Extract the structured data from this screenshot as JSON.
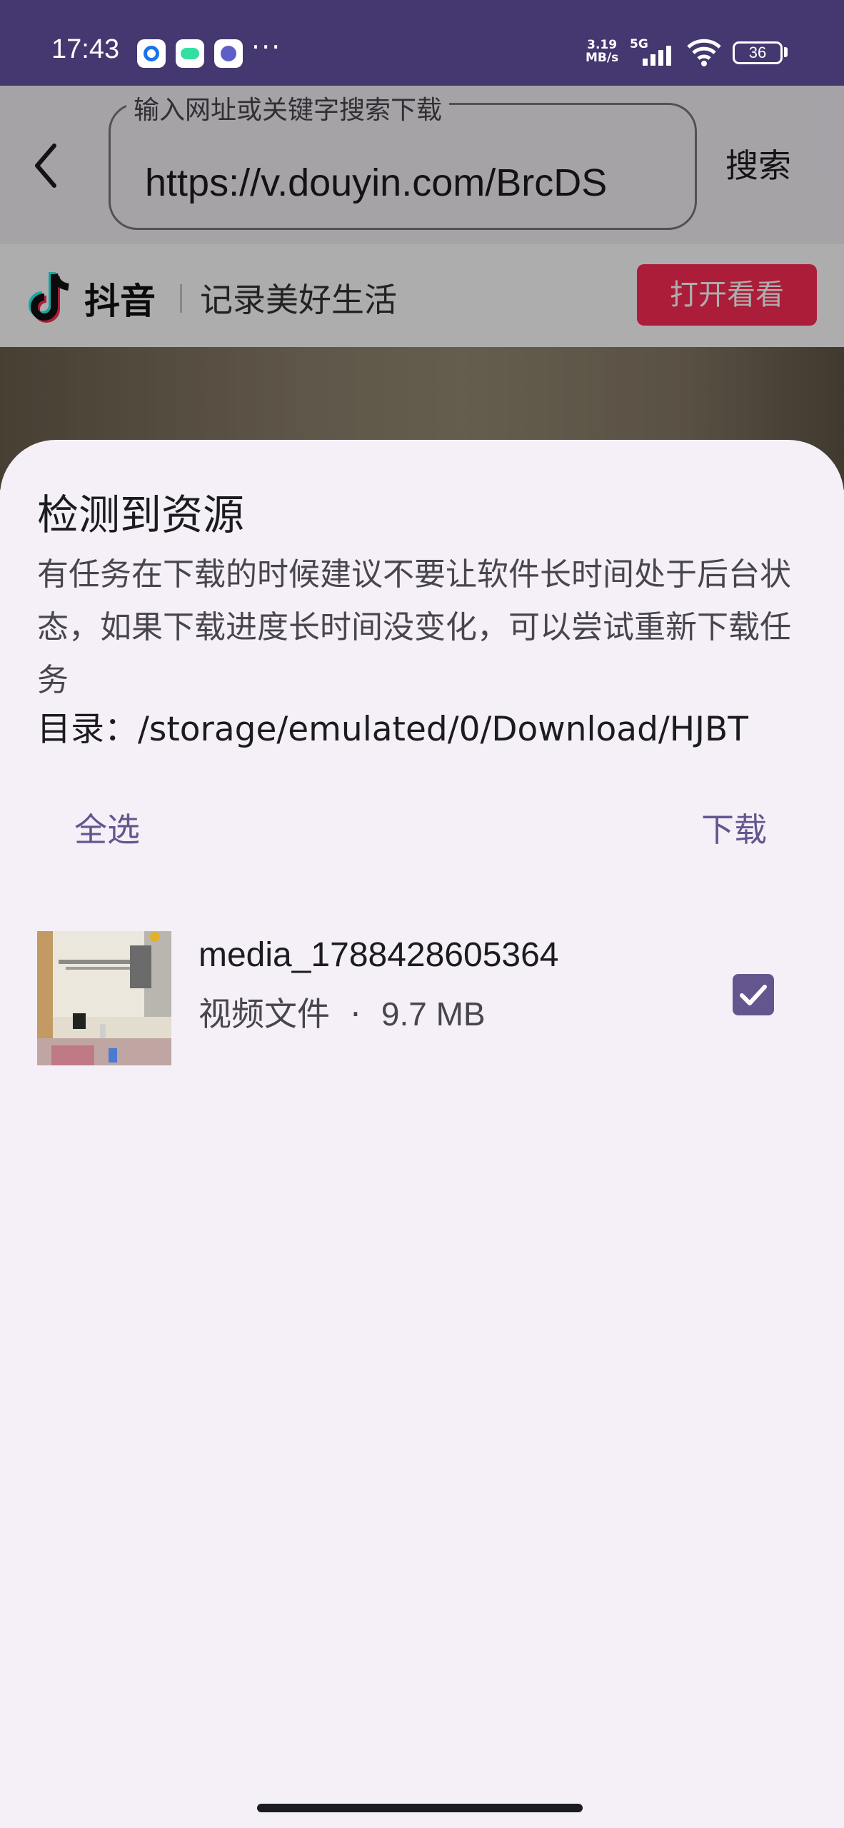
{
  "status_bar": {
    "time": "17:43",
    "notification_icons": [
      "circle-app-icon",
      "tripadvisor-icon",
      "meta-app-icon"
    ],
    "more": "···",
    "network_speed_value": "3.19",
    "network_speed_unit": "MB/s",
    "network_type": "5G",
    "battery": "36"
  },
  "browser": {
    "url_label": "输入网址或关键字搜索下载",
    "url_value": "https://v.douyin.com/BrcDS",
    "search_label": "搜索"
  },
  "webpage": {
    "app_name": "抖音",
    "slogan": "记录美好生活",
    "open_button": "打开看看",
    "brand_color": "#fe2c55"
  },
  "sheet": {
    "title": "检测到资源",
    "description": "有任务在下载的时候建议不要让软件长时间处于后台状态，如果下载进度长时间没变化，可以尝试重新下载任务",
    "directory_label": "目录：",
    "directory_path": "/storage/emulated/0/Download/HJBT",
    "select_all": "全选",
    "download": "下载",
    "accent_color": "#65558f",
    "items": [
      {
        "name": "media_1788428605364",
        "type": "视频文件",
        "separator": "·",
        "size": "9.7 MB",
        "checked": true
      }
    ]
  }
}
